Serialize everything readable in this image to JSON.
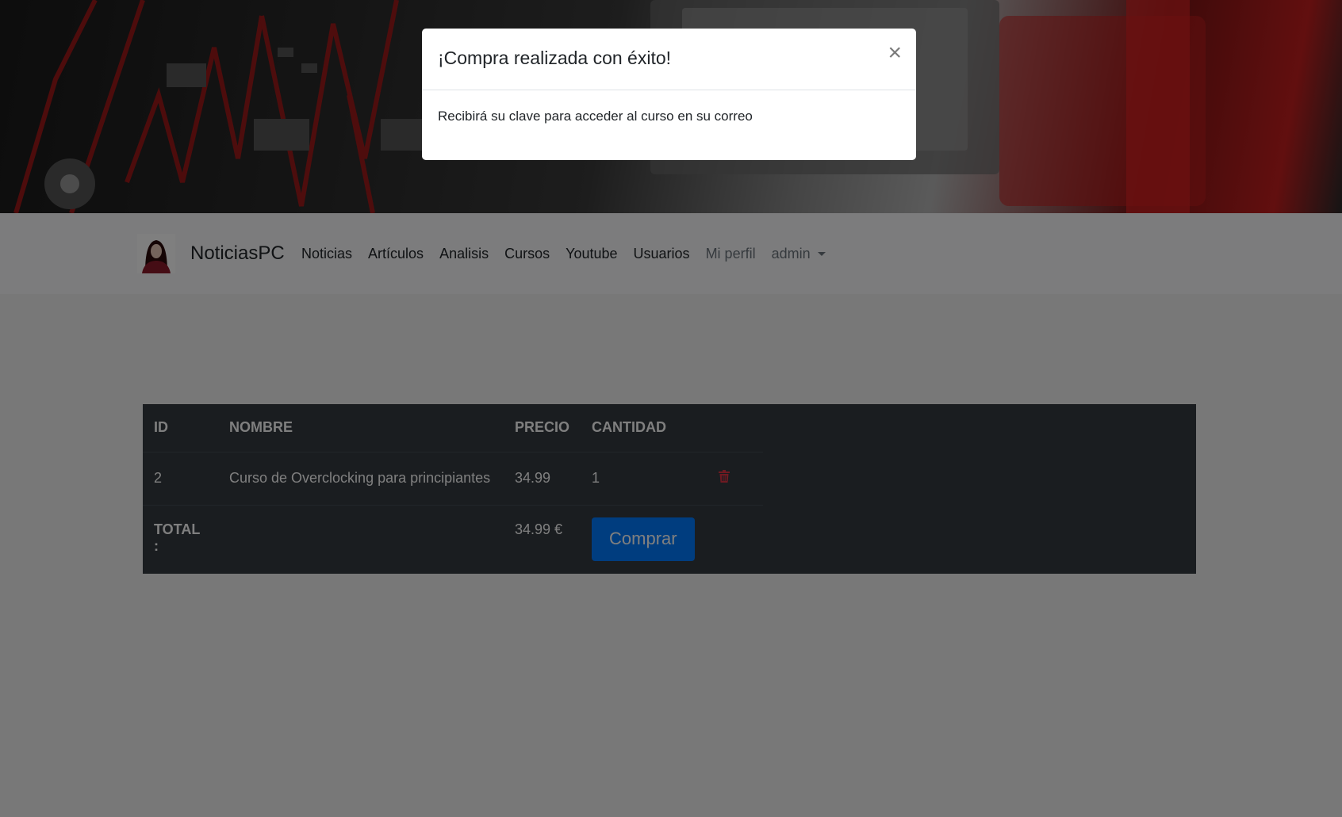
{
  "navbar": {
    "brand": "NoticiasPC",
    "links": [
      {
        "label": "Noticias"
      },
      {
        "label": "Artículos"
      },
      {
        "label": "Analisis"
      },
      {
        "label": "Cursos"
      },
      {
        "label": "Youtube"
      },
      {
        "label": "Usuarios"
      },
      {
        "label": "Mi perfil"
      },
      {
        "label": "admin"
      }
    ]
  },
  "cart": {
    "headers": {
      "id": "ID",
      "nombre": "NOMBRE",
      "precio": "PRECIO",
      "cantidad": "CANTIDAD"
    },
    "rows": [
      {
        "id": "2",
        "nombre": "Curso de Overclocking para principiantes",
        "precio": "34.99",
        "cantidad": "1"
      }
    ],
    "total_label": "TOTAL :",
    "total_value": "34.99 €",
    "buy_label": "Comprar"
  },
  "modal": {
    "title": "¡Compra realizada con éxito!",
    "close_glyph": "×",
    "body": "Recibirá su clave para acceder al curso en su correo"
  },
  "icons": {
    "brand": "avatar-woman-icon",
    "delete": "trash-icon",
    "dropdown": "caret-down-icon",
    "close": "close-icon"
  },
  "colors": {
    "primary": "#007bff",
    "danger": "#dc3545",
    "table_dark": "#343a40"
  }
}
